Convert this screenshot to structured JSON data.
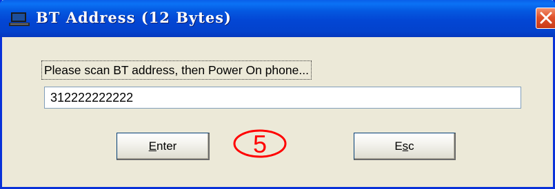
{
  "window": {
    "title": "BT Address (12 Bytes)",
    "close_label": "X"
  },
  "dialog": {
    "prompt": "Please scan BT address, then Power On phone...",
    "address_value": "312222222222",
    "enter_prefix": "",
    "enter_mnemonic": "E",
    "enter_rest": "nter",
    "esc_prefix": "E",
    "esc_mnemonic": "s",
    "esc_rest": "c"
  },
  "annotation": {
    "step_label": "5",
    "color": "#ff0000"
  },
  "colors": {
    "titlebar": "#0458e0",
    "dialog_bg": "#ece9d8",
    "close_button": "#e0512b"
  }
}
